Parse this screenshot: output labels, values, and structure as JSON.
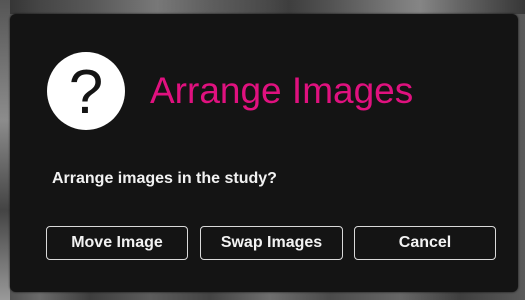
{
  "dialog": {
    "icon": "question-mark-icon",
    "icon_glyph": "?",
    "title": "Arrange Images",
    "message": "Arrange images in the study?",
    "buttons": {
      "move_label": "Move Image",
      "swap_label": "Swap Images",
      "cancel_label": "Cancel"
    }
  },
  "colors": {
    "title_accent": "#e0117f",
    "dialog_background": "#141414",
    "text": "#f2f2f2",
    "button_border": "#d9d9d9",
    "icon_background": "#ffffff"
  }
}
